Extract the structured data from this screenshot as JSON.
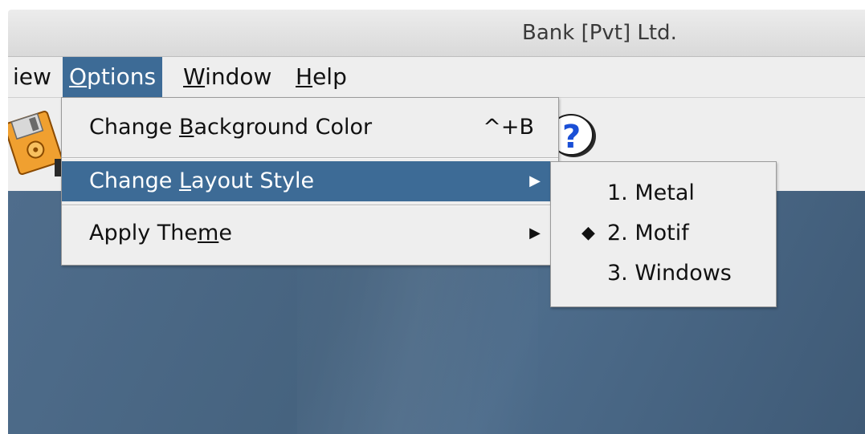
{
  "window": {
    "title": "Bank [Pvt] Ltd."
  },
  "menubar": {
    "items": [
      {
        "label": "iew",
        "mnemonic": ""
      },
      {
        "label_before": "",
        "mnemonic": "O",
        "label_after": "ptions"
      },
      {
        "label_before": "",
        "mnemonic": "W",
        "label_after": "indow"
      },
      {
        "label_before": "",
        "mnemonic": "H",
        "label_after": "elp"
      }
    ],
    "active": "Options"
  },
  "options_menu": {
    "items": [
      {
        "before": "Change ",
        "mnemonic": "B",
        "after": "ackground Color",
        "accelerator": "^+B",
        "arrow": ""
      },
      {
        "before": "Change ",
        "mnemonic": "L",
        "after": "ayout Style",
        "accelerator": "",
        "arrow": "▶"
      },
      {
        "before": "Apply The",
        "mnemonic": "m",
        "after": "e",
        "accelerator": "",
        "arrow": "▶"
      }
    ],
    "selected_index": 1
  },
  "layout_submenu": {
    "items": [
      {
        "label": "1. Metal",
        "mark": ""
      },
      {
        "label": "2. Motif",
        "mark": "◆"
      },
      {
        "label": "3. Windows",
        "mark": ""
      }
    ]
  },
  "toolbar": {
    "icons": [
      "save-disk-icon",
      "help-question-icon"
    ]
  },
  "colors": {
    "menu_highlight": "#3d6b96",
    "desktop_background": "#4a6a89",
    "menu_background": "#eeeeee"
  }
}
